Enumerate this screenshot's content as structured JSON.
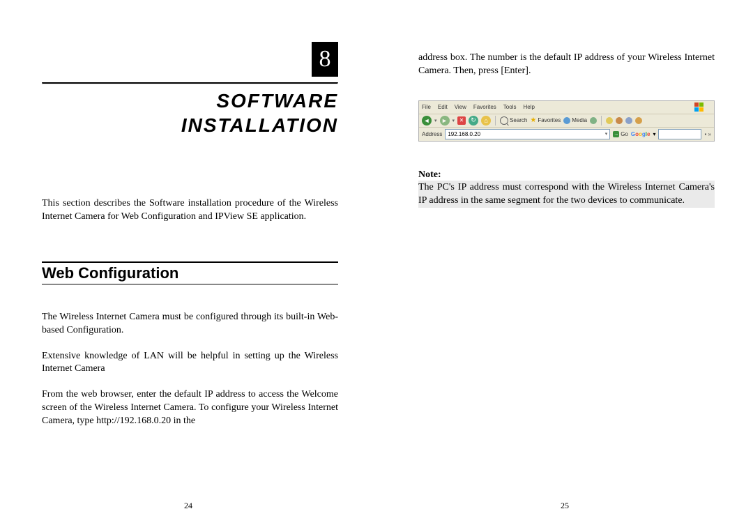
{
  "left": {
    "chapter_number": "8",
    "title_line1": "SOFTWARE",
    "title_line2": "INSTALLATION",
    "intro": "This section describes the Software installation procedure of the Wireless Internet Camera for Web Configuration and IPView SE application.",
    "section_heading": "Web Configuration",
    "para1": "The Wireless Internet Camera must be configured through its built-in Web-based Configuration.",
    "para2": "Extensive knowledge of LAN will be helpful in setting up the Wireless Internet Camera",
    "para3": "From the web browser, enter the default IP address to access the Welcome screen of the Wireless Internet Camera.  To configure your Wireless Internet Camera, type http://192.168.0.20 in the",
    "page_number": "24"
  },
  "right": {
    "continued": "address box.  The number is the default IP address of your Wireless Internet Camera.  Then, press [Enter].",
    "browser": {
      "menu": {
        "file": "File",
        "edit": "Edit",
        "view": "View",
        "favorites": "Favorites",
        "tools": "Tools",
        "help": "Help"
      },
      "toolbar": {
        "search": "Search",
        "favorites": "Favorites",
        "media": "Media"
      },
      "address_label": "Address",
      "address_value": "192.168.0.20",
      "go": "Go",
      "google": "Google"
    },
    "note_label": "Note:",
    "note_body": "The PC's IP address must correspond with the Wireless Internet Camera's IP address in the same segment for the two devices to communicate.",
    "page_number": "25"
  }
}
